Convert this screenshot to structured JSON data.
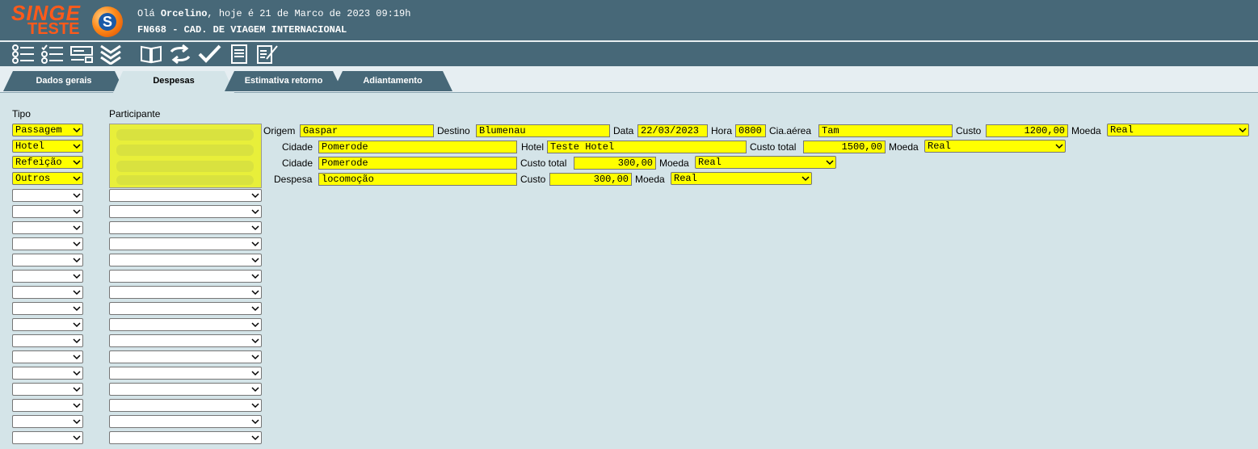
{
  "header": {
    "logo_top": "SINGE",
    "logo_bottom": "TESTE",
    "logo_mark": "S",
    "greeting_prefix": "Olá",
    "user": "Orcelino",
    "greeting_suffix": ", hoje é 21 de Marco de 2023 09:19h",
    "screen_title": "FN668 - CAD. DE VIAGEM INTERNACIONAL"
  },
  "toolbar": [
    "list-icon",
    "checklist-icon",
    "form-icon",
    "double-chevron-down-icon",
    "book-icon",
    "refresh-icon",
    "check-icon",
    "document-icon",
    "edit-document-icon"
  ],
  "tabs": [
    "Dados gerais",
    "Despesas",
    "Estimativa retorno",
    "Adiantamento"
  ],
  "active_tab": "Despesas",
  "labels": {
    "tipo": "Tipo",
    "participante": "Participante"
  },
  "tipo": [
    "Passagem",
    "Hotel",
    "Refeição",
    "Outros"
  ],
  "passagem": {
    "origem_label": "Origem",
    "origem": "Gaspar",
    "destino_label": "Destino",
    "destino": "Blumenau",
    "data_label": "Data",
    "data": "22/03/2023",
    "hora_label": "Hora",
    "hora": "0800",
    "cia_label": "Cia.aérea",
    "cia": "Tam",
    "custo_label": "Custo",
    "custo": "1200,00",
    "moeda_label": "Moeda",
    "moeda": "Real"
  },
  "hotel": {
    "cidade_label": "Cidade",
    "cidade": "Pomerode",
    "hotel_label": "Hotel",
    "hotel": "Teste Hotel",
    "custo_label": "Custo total",
    "custo": "1500,00",
    "moeda_label": "Moeda",
    "moeda": "Real"
  },
  "refeicao": {
    "cidade_label": "Cidade",
    "cidade": "Pomerode",
    "custo_label": "Custo total",
    "custo": "300,00",
    "moeda_label": "Moeda",
    "moeda": "Real"
  },
  "outros": {
    "despesa_label": "Despesa",
    "despesa": "locomoção",
    "custo_label": "Custo",
    "custo": "300,00",
    "moeda_label": "Moeda",
    "moeda": "Real"
  },
  "colors": {
    "header": "#476878",
    "field_highlight": "#ffff00",
    "background": "#d4e4e8",
    "logo": "#ff5a1a"
  }
}
